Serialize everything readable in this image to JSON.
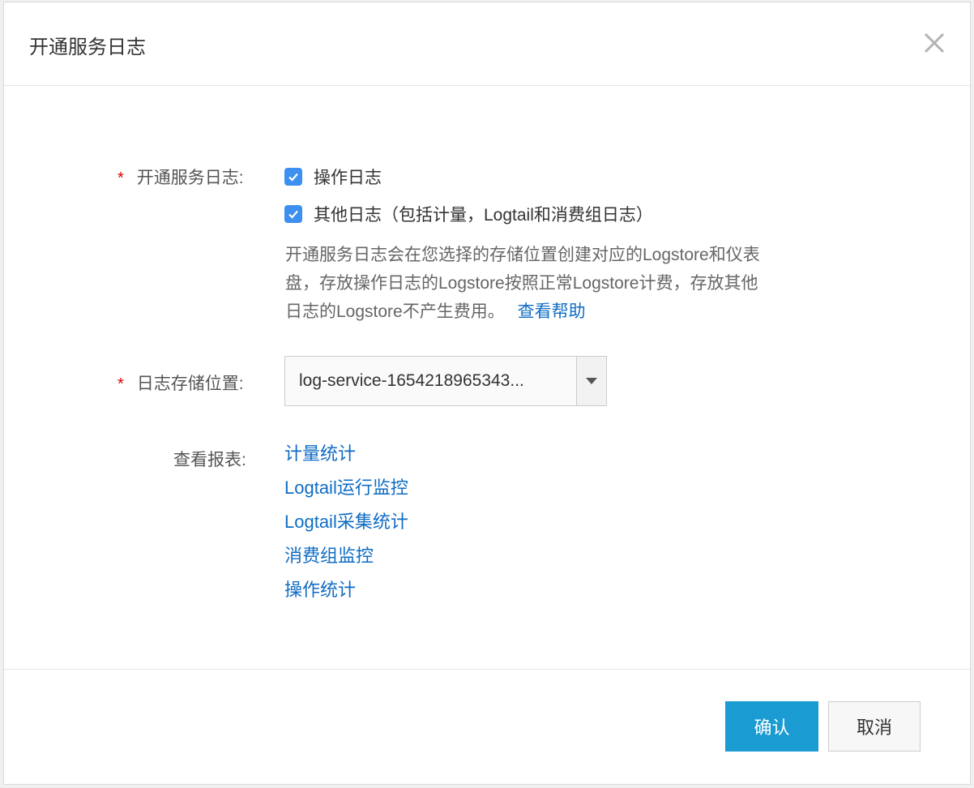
{
  "dialog": {
    "title": "开通服务日志",
    "close_icon": "close-icon"
  },
  "form": {
    "service_log": {
      "label": "开通服务日志:",
      "required_mark": "*",
      "options": [
        {
          "label": "操作日志",
          "checked": true
        },
        {
          "label": "其他日志（包括计量，Logtail和消费组日志）",
          "checked": true
        }
      ],
      "hint_line1": "开通服务日志会在您选择的存储位置创建对应的Logstore和仪表",
      "hint_line2": "盘，存放操作日志的Logstore按照正常Logstore计费，存放其他",
      "hint_line3": "日志的Logstore不产生费用。",
      "help_link": "查看帮助"
    },
    "storage": {
      "label": "日志存储位置:",
      "required_mark": "*",
      "selected_value": "log-service-1654218965343..."
    },
    "reports": {
      "label": "查看报表:",
      "links": [
        "计量统计",
        "Logtail运行监控",
        "Logtail采集统计",
        "消费组监控",
        "操作统计"
      ]
    }
  },
  "footer": {
    "confirm_label": "确认",
    "cancel_label": "取消"
  },
  "colors": {
    "primary": "#1a9bd2",
    "link": "#0f6cc4",
    "checkbox": "#3d8ff0",
    "required": "#e00000"
  }
}
